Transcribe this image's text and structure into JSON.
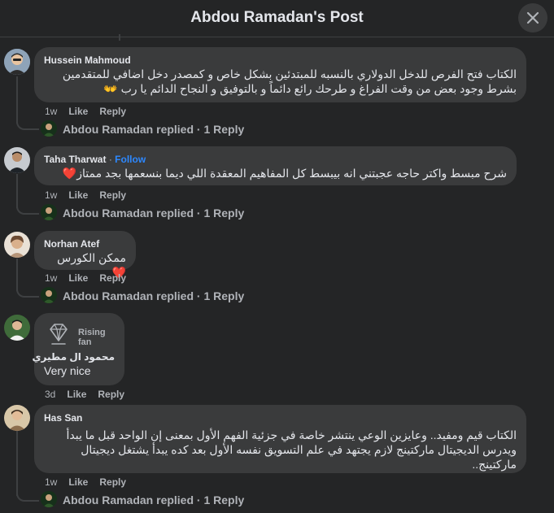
{
  "header": {
    "title": "Abdou Ramadan's Post"
  },
  "comments": [
    {
      "author": "Hussein Mahmoud",
      "lines": [
        "الكتاب فتح الفرص للدخل الدولاري بالنسبه للمبتدئين بشكل خاص و كمصدر دخل اضافي للمتقدمين",
        "بشرط وجود بعض من وقت الفراغ و طرحك رائع دائماً و بالتوفيق و النجاح الدائم يا رب 👐"
      ],
      "time": "1w",
      "like": "Like",
      "reply": "Reply",
      "replied": "Abdou Ramadan replied · 1 Reply"
    },
    {
      "author": "Taha Tharwat",
      "sep": "·",
      "follow": "Follow",
      "lines": [
        "شرح مبسط واكتر حاجه عجبتني انه بيبسط كل المفاهيم المعقدة اللي ديما بنسعمها بجد ممتاز❤️"
      ],
      "time": "1w",
      "like": "Like",
      "reply": "Reply",
      "replied": "Abdou Ramadan replied · 1 Reply"
    },
    {
      "author": "Norhan Atef",
      "lines": [
        "ممكن الكورس ❤️"
      ],
      "time": "1w",
      "like": "Like",
      "reply": "Reply",
      "replied": "Abdou Ramadan replied · 1 Reply"
    },
    {
      "badge": "Rising fan",
      "author": "محمود ال مطيري",
      "lines": [
        "Very nice"
      ],
      "time": "3d",
      "like": "Like",
      "reply": "Reply"
    },
    {
      "author": "Has San",
      "lines": [
        "الكتاب قيم ومفيد.. وعايزين الوعي ينتشر خاصة في جزئية الفهم الأول بمعنى إن الواحد قبل ما يبدأ",
        "ويدرس الديجيتال ماركتينج لازم يجتهد في علم التسويق نفسه الأول بعد كده يبدأ يشتغل ديجيتال",
        "ماركتينج.."
      ],
      "time": "1w",
      "like": "Like",
      "reply": "Reply",
      "replied": "Abdou Ramadan replied · 1 Reply"
    }
  ],
  "colors": {
    "accent": "#2d88ff",
    "bubble": "#3a3b3c",
    "background": "#242526"
  },
  "icons": {
    "close": "close-icon",
    "rising_fan": "diamond-icon"
  }
}
